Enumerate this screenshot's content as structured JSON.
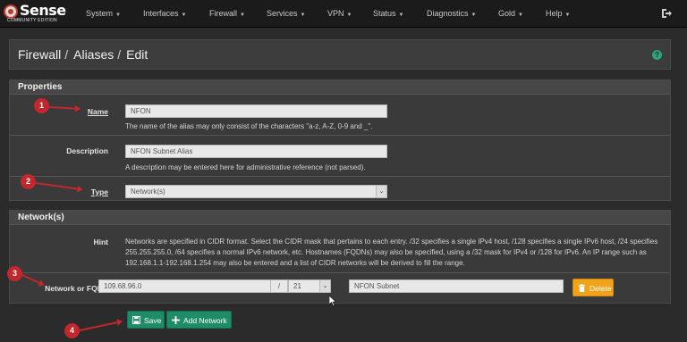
{
  "nav": {
    "brand": "Sense",
    "edition": "COMMUNITY EDITION",
    "menu": [
      "System",
      "Interfaces",
      "Firewall",
      "Services",
      "VPN",
      "Status",
      "Diagnostics",
      "Gold",
      "Help"
    ]
  },
  "breadcrumb": {
    "items": [
      "Firewall",
      "Aliases",
      "Edit"
    ]
  },
  "properties": {
    "title": "Properties",
    "name_label": "Name",
    "name_value": "NFON",
    "name_help": "The name of the alias may only consist of the characters \"a-z, A-Z, 0-9 and _\".",
    "description_label": "Description",
    "description_value": "NFON Subnet Alias",
    "description_help": "A description may be entered here for administrative reference (not parsed).",
    "type_label": "Type",
    "type_value": "Network(s)"
  },
  "networks": {
    "title": "Network(s)",
    "hint_label": "Hint",
    "hint_text": "Networks are specified in CIDR format. Select the CIDR mask that pertains to each entry. /32 specifies a single IPv4 host, /128 specifies a single IPv6 host, /24 specifies 255.255.255.0, /64 specifies a normal IPv6 network, etc. Hostnames (FQDNs) may also be specified, using a /32 mask for IPv4 or /128 for IPv6. An IP range such as 192.168.1.1-192.168.1.254 may also be entered and a list of CIDR networks will be derived to fill the range.",
    "entry_label": "Network or FQDN",
    "network_value": "109.68.96.0",
    "slash": "/",
    "mask_value": "21",
    "entry_description": "NFON Subnet",
    "delete_label": "Delete"
  },
  "actions": {
    "save_label": "Save",
    "add_network_label": "Add Network"
  },
  "annotations": [
    "1",
    "2",
    "3",
    "4"
  ],
  "colors": {
    "accent_green": "#1e8c66",
    "delete_orange": "#f0a21a",
    "annotation_red": "#c1272d"
  }
}
